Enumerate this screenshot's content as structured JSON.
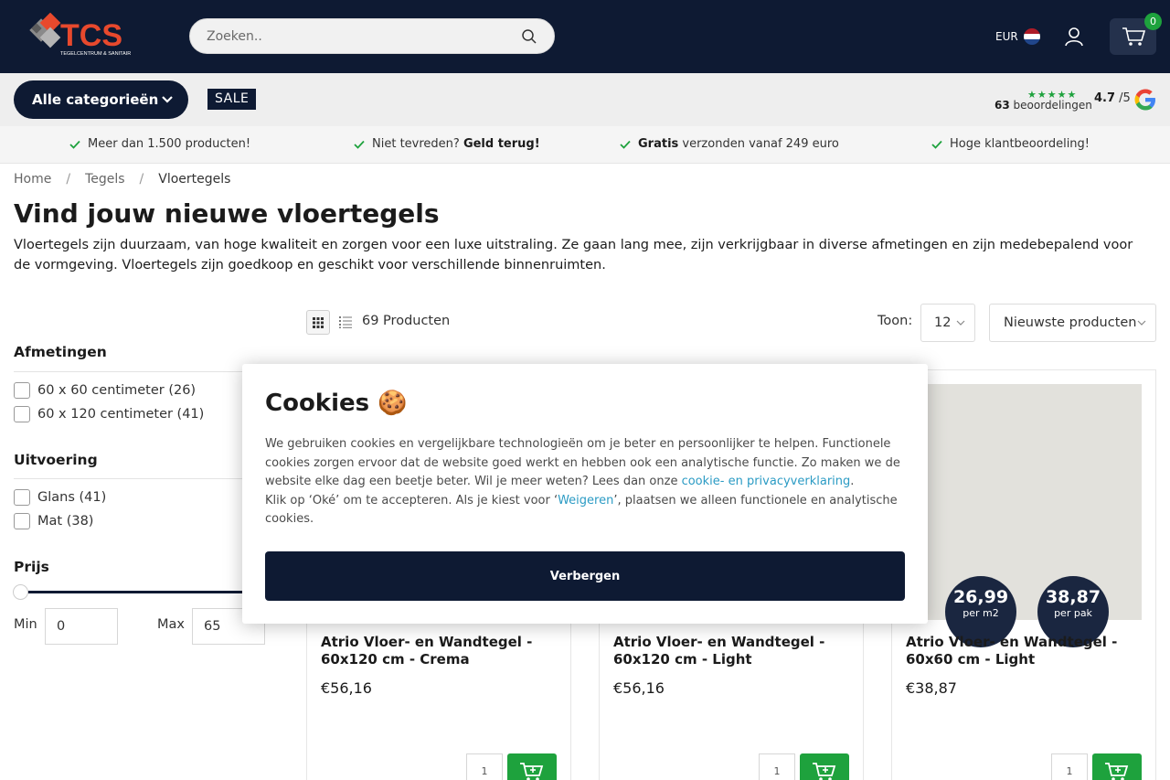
{
  "header": {
    "logo_text": "TCS",
    "logo_subtext": "TEGELCENTRUM & SANITAIR",
    "search_placeholder": "Zoeken..",
    "currency": "EUR",
    "cart_count": "0"
  },
  "catbar": {
    "categories_label": "Alle categorieën",
    "sale_label": "SALE",
    "review_count": "63",
    "review_word": "beoordelingen",
    "stars": "★★★★★",
    "rating": "4.7",
    "rating_max": "/5"
  },
  "usps": [
    {
      "text": "Meer dan 1.500 producten!",
      "bold": ""
    },
    {
      "text": "Niet tevreden? ",
      "bold": "Geld terug!"
    },
    {
      "bold": "Gratis",
      "text": " verzonden vanaf 249 euro"
    },
    {
      "text": "Hoge klantbeoordeling!",
      "bold": ""
    }
  ],
  "breadcrumb": [
    "Home",
    "Tegels",
    "Vloertegels"
  ],
  "page": {
    "title": "Vind jouw nieuwe vloertegels",
    "intro": "Vloertegels zijn duurzaam, van hoge kwaliteit en zorgen voor een luxe uitstraling. Ze gaan lang mee, zijn verkrijgbaar in diverse afmetingen en zijn medebepalend voor de vormgeving. Vloertegels zijn goedkoop en geschikt voor verschillende binnenruimten."
  },
  "toolbar": {
    "product_count": "69 Producten",
    "toon_label": "Toon:",
    "toon_value": "12",
    "sort_value": "Nieuwste producten"
  },
  "filters": {
    "afmetingen": {
      "title": "Afmetingen",
      "options": [
        "60 x 60 centimeter (26)",
        "60 x 120 centimeter (41)"
      ]
    },
    "uitvoering": {
      "title": "Uitvoering",
      "options": [
        "Glans (41)",
        "Mat (38)"
      ]
    },
    "prijs": {
      "title": "Prijs",
      "min_label": "Min",
      "min_value": "0",
      "max_label": "Max",
      "max_value": "65"
    }
  },
  "products": [
    {
      "name": "Atrio Vloer- en Wandtegel - 60x120 cm - Crema",
      "price": "€56,16",
      "qty": "1"
    },
    {
      "name": "Atrio Vloer- en Wandtegel - 60x120 cm - Light",
      "price": "€56,16",
      "qty": "1"
    },
    {
      "name": "Atrio Vloer- en Wandtegel - 60x60 cm - Light",
      "price": "€38,87",
      "qty": "1",
      "badge1_big": "26,99",
      "badge1_small": "per m2",
      "badge2_big": "38,87",
      "badge2_small": "per pak"
    }
  ],
  "cookie": {
    "title": "Cookies",
    "title_icon": "🍪",
    "text1": "We gebruiken cookies en vergelijkbare technologieën om je beter en persoonlijker te helpen. Functionele cookies zorgen ervoor dat de website goed werkt en hebben ook een analytische functie. Zo maken we de website elke dag een beetje beter. Wil je meer weten? Lees dan onze ",
    "link1": "cookie- en privacyverklaring",
    "text2": ".",
    "text3": "Klik op ‘Oké’ om te accepteren. Als je kiest voor ‘",
    "link2": "Weigeren",
    "text4": "’, plaatsen we alleen functionele en analytische cookies.",
    "button": "Verbergen"
  },
  "colors": {
    "navy": "#0e1a33",
    "green": "#1ea23d",
    "link": "#2b9bc4",
    "logo_orange": "#e8492d"
  }
}
